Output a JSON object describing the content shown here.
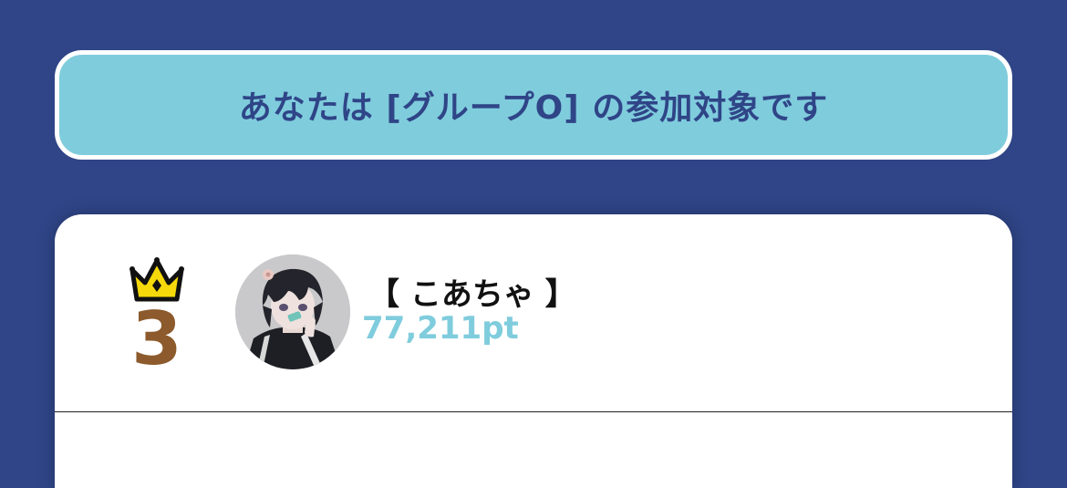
{
  "banner": {
    "text": "あなたは [グループO] の参加対象です"
  },
  "ranking": {
    "entries": [
      {
        "rank": "3",
        "name": "【 こあちゃ 】",
        "points": "77,211pt",
        "crown_icon": "crown-icon",
        "crown_color": "#f5d90a",
        "rank_color": "#8c5a2c"
      }
    ]
  },
  "colors": {
    "background": "#2f4587",
    "banner_fill": "#7fccdd",
    "banner_text": "#2f4587",
    "points": "#7fccdd"
  }
}
